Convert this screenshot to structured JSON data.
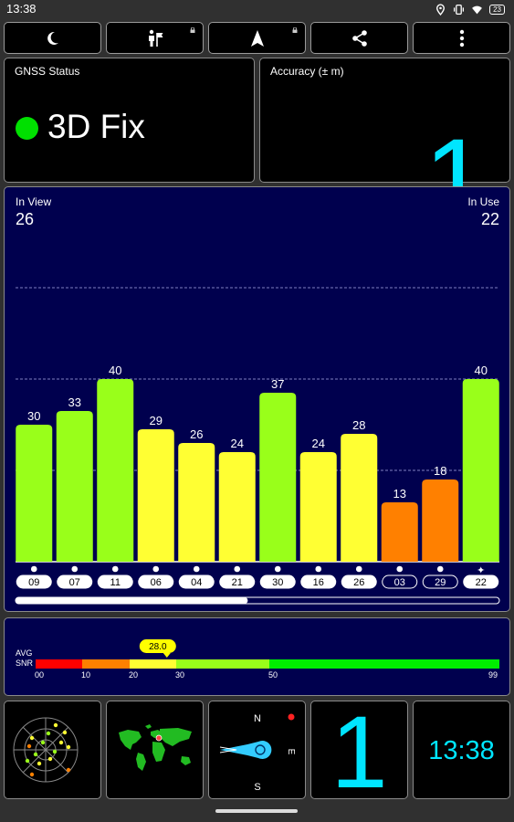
{
  "status_bar": {
    "time": "13:38",
    "battery": "23",
    "icons": [
      "location-icon",
      "vibrate-icon",
      "wifi-icon",
      "battery-icon"
    ]
  },
  "toolbar": {
    "buttons": [
      {
        "name": "night-mode-button",
        "icon": "moon-icon",
        "locked": false
      },
      {
        "name": "fix-tools-button",
        "icon": "person-flag-icon",
        "locked": true
      },
      {
        "name": "navigation-button",
        "icon": "navigation-arrow-icon",
        "locked": true
      },
      {
        "name": "share-button",
        "icon": "share-icon",
        "locked": false
      },
      {
        "name": "more-options-button",
        "icon": "more-vert-icon",
        "locked": false
      }
    ]
  },
  "gnss_status": {
    "label": "GNSS Status",
    "value": "3D Fix",
    "indicator_color": "#00e000"
  },
  "accuracy": {
    "label": "Accuracy (± m)",
    "value": "1"
  },
  "satellites": {
    "in_view_label": "In View",
    "in_view": "26",
    "in_use_label": "In Use",
    "in_use": "22",
    "scroll_fraction": 0.48
  },
  "chart_data": {
    "type": "bar",
    "categories": [
      "09",
      "07",
      "11",
      "06",
      "04",
      "21",
      "30",
      "16",
      "26",
      "03",
      "29",
      "22"
    ],
    "values": [
      30,
      33,
      40,
      29,
      26,
      24,
      37,
      24,
      28,
      13,
      18,
      40
    ],
    "in_use": [
      true,
      true,
      true,
      true,
      true,
      true,
      true,
      true,
      true,
      false,
      false,
      true
    ],
    "markers": [
      "dot",
      "dot",
      "dot",
      "dot",
      "dot",
      "dot",
      "dot",
      "dot",
      "dot",
      "dot",
      "dot",
      "star"
    ],
    "ylim": [
      0,
      80
    ],
    "grid": true,
    "colors": {
      "high": "#99ff1a",
      "mid": "#ffff33",
      "low": "#ff8000",
      "grid": "#8080c0"
    }
  },
  "snr": {
    "label_line1": "AVG",
    "label_line2": "SNR",
    "avg_value": "28.0",
    "avg": 28.0,
    "scale": [
      "00",
      "10",
      "20",
      "30",
      "50",
      "99"
    ],
    "segments": [
      {
        "from": 0,
        "to": 10,
        "color": "#ff0000"
      },
      {
        "from": 10,
        "to": 20,
        "color": "#ff8000"
      },
      {
        "from": 20,
        "to": 30,
        "color": "#ffff33"
      },
      {
        "from": 30,
        "to": 50,
        "color": "#99ff1a"
      },
      {
        "from": 50,
        "to": 99,
        "color": "#00ee00"
      }
    ]
  },
  "tiles": {
    "compass_n": "N",
    "compass_e": "E",
    "compass_s": "S",
    "accuracy_value": "1",
    "clock": "13:38"
  }
}
